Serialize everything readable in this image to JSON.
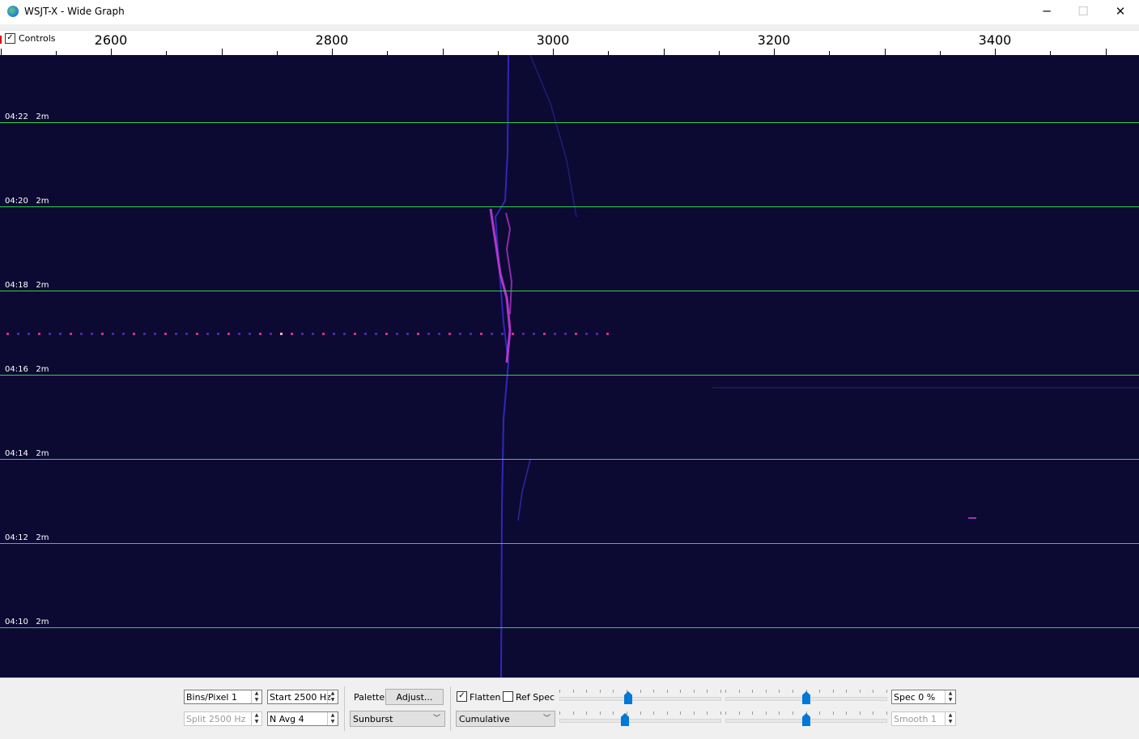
{
  "window": {
    "title": "WSJT-X - Wide Graph",
    "minimize_glyph": "─",
    "maximize_glyph": "☐",
    "close_glyph": "✕"
  },
  "scale": {
    "controls_label": "Controls",
    "controls_checked": true,
    "freq_labels": [
      "2600",
      "2800",
      "3000",
      "3200",
      "3400"
    ]
  },
  "waterfall": {
    "time_marks": [
      {
        "time": "04:22",
        "interval": "2m"
      },
      {
        "time": "04:20",
        "interval": "2m"
      },
      {
        "time": "04:18",
        "interval": "2m"
      },
      {
        "time": "04:16",
        "interval": "2m"
      },
      {
        "time": "04:14",
        "interval": "2m"
      },
      {
        "time": "04:12",
        "interval": "2m"
      },
      {
        "time": "04:10",
        "interval": "2m"
      }
    ],
    "background_color": "#0c0a33",
    "timeline_color": "#2fd24a",
    "signal_color": "#c03cd8"
  },
  "controls": {
    "bins_pixel": "Bins/Pixel  1",
    "start": "Start 2500 Hz",
    "split": "Split  2500  Hz",
    "n_avg": "N Avg 4",
    "palette_label": "Palette",
    "adjust_button": "Adjust...",
    "palette_value": "Sunburst",
    "flatten_label": "Flatten",
    "flatten_checked": true,
    "ref_spec_label": "Ref Spec",
    "ref_spec_checked": false,
    "spectrum_mode": "Cumulative",
    "spec": "Spec 0 %",
    "smooth": "Smooth  1",
    "slider_gain_1": 0.42,
    "slider_zero_1": 0.4,
    "slider_gain_2": 0.5,
    "slider_zero_2": 0.5,
    "accent_color": "#0078d7"
  }
}
